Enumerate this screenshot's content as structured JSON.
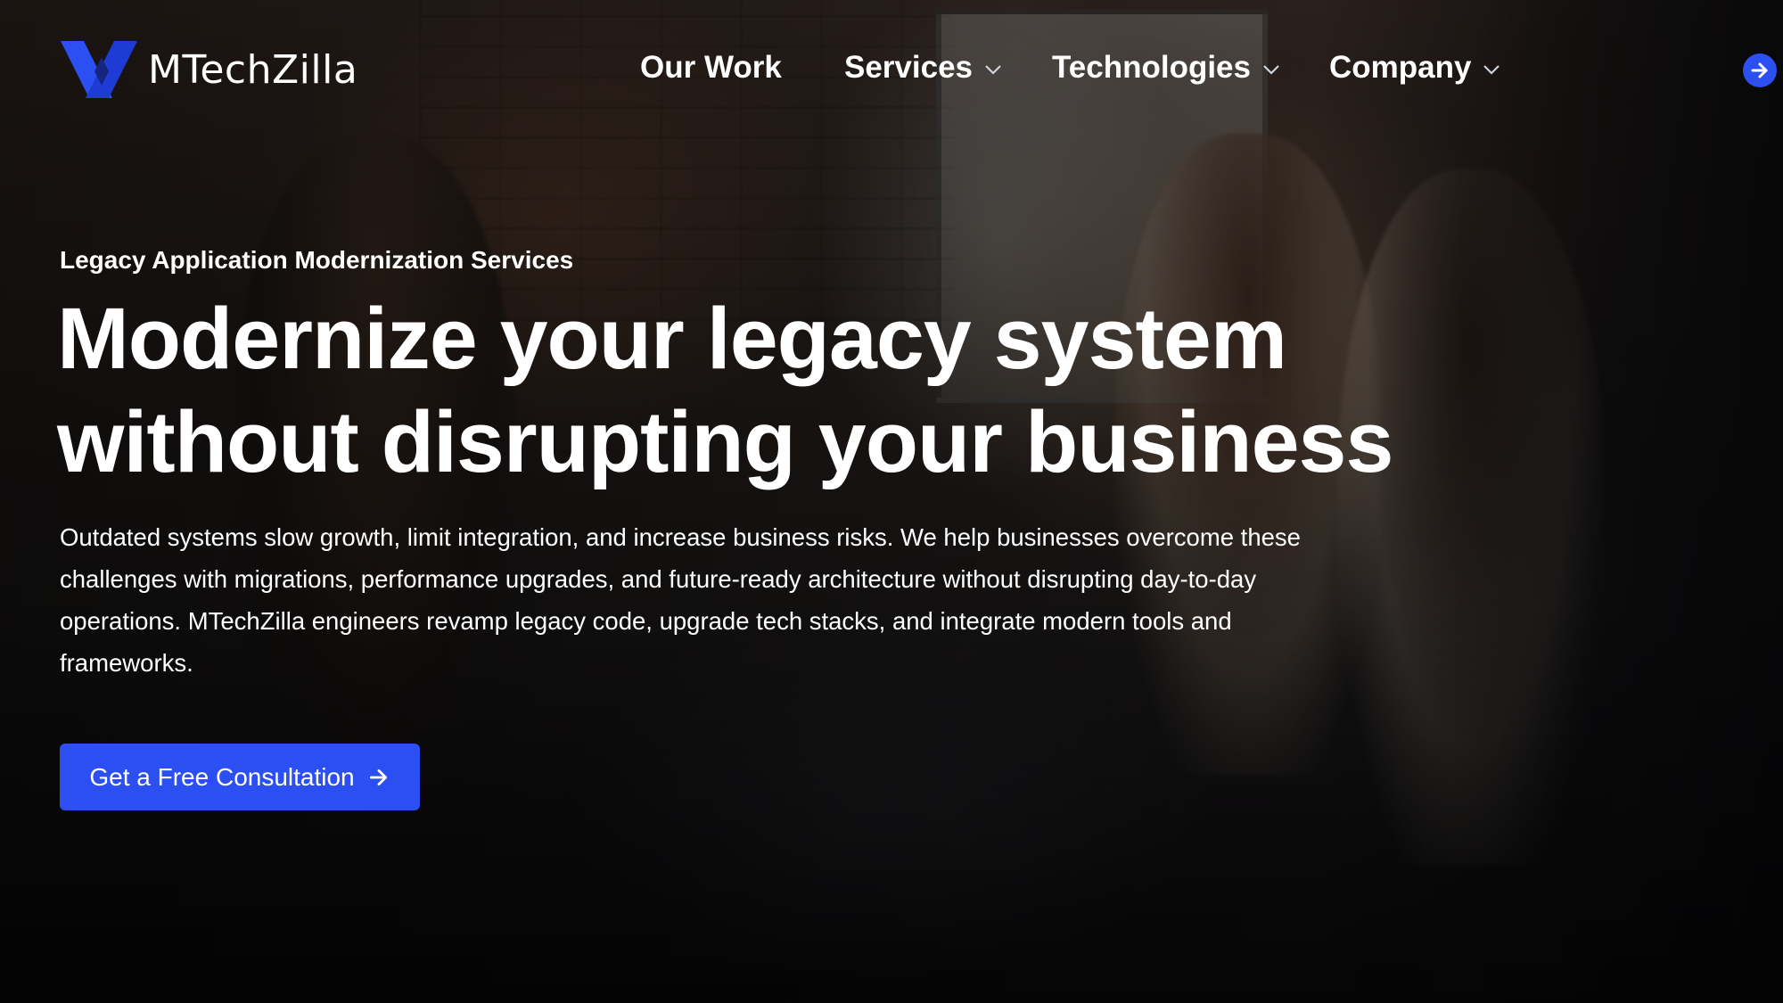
{
  "brand": {
    "name": "MTechZilla",
    "accent_color": "#2b4ff0"
  },
  "nav": {
    "items": [
      {
        "label": "Our Work",
        "has_dropdown": false
      },
      {
        "label": "Services",
        "has_dropdown": true
      },
      {
        "label": "Technologies",
        "has_dropdown": true
      },
      {
        "label": "Company",
        "has_dropdown": true
      }
    ],
    "arrow_icon": "arrow-right-icon"
  },
  "hero": {
    "eyebrow": "Legacy Application Modernization Services",
    "headline_line1": "Modernize your legacy system",
    "headline_line2": "without disrupting your business",
    "description_lines": [
      "Outdated systems slow growth, limit integration, and increase business risks. We help businesses overcome these",
      "challenges with migrations, performance upgrades, and future-ready architecture without disrupting day-to-day",
      "operations. MTechZilla engineers revamp legacy code, upgrade tech stacks, and integrate modern tools and",
      "frameworks."
    ],
    "cta_label": "Get a Free Consultation",
    "cta_icon": "arrow-right-icon"
  }
}
